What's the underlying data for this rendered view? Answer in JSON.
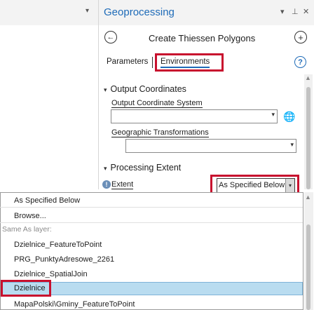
{
  "left_strip": {
    "caret": "▾"
  },
  "pane": {
    "title": "Geoprocessing",
    "header_buttons": [
      "▾",
      "⊥",
      "✕"
    ],
    "tool_name": "Create Thiessen Polygons",
    "back_icon": "⊖",
    "add_icon": "⊕",
    "tabs": [
      "Parameters",
      "Environments"
    ],
    "active_tab": "Environments",
    "help_icon": "?"
  },
  "sections": {
    "output_coordinates": {
      "header": "Output Coordinates",
      "output_coordinate_system_label": "Output Coordinate System",
      "output_coordinate_system_value": "",
      "geographic_transformations_label": "Geographic Transformations",
      "geographic_transformations_value": ""
    },
    "processing_extent": {
      "header": "Processing Extent",
      "extent_label": "Extent",
      "extent_value": "As Specified Below"
    }
  },
  "dropdown": {
    "items": [
      "As Specified Below",
      "Browse..."
    ],
    "group_label": "Same As layer:",
    "layers": [
      "Dzielnice_FeatureToPoint",
      "PRG_PunktyAdresowe_2261",
      "Dzielnice_SpatialJoin",
      "Dzielnice",
      "MapaPolski\\Gminy_FeatureToPoint"
    ],
    "selected": "Dzielnice"
  },
  "colors": {
    "accent": "#1e6bb8",
    "highlight": "#c8102e",
    "selection": "#b9dcf0"
  }
}
